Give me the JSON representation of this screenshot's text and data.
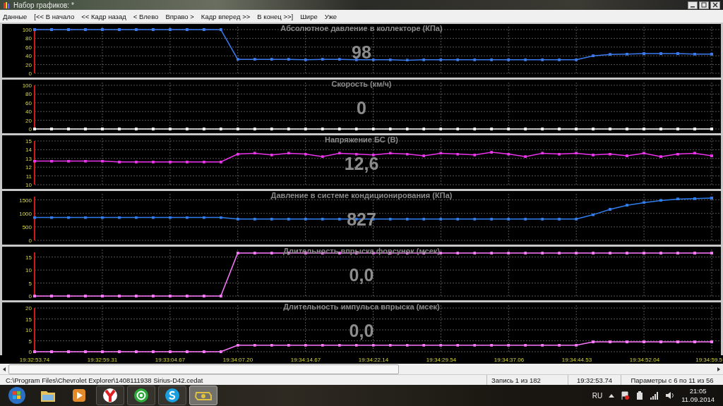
{
  "window": {
    "title": "Набор графиков: *"
  },
  "menu": [
    "Данные",
    "[<< В начало",
    "<< Кадр назад",
    "< Влево",
    "Вправо >",
    "Кадр вперед >>",
    "В конец >>]",
    "Шире",
    "Уже"
  ],
  "panels": [
    {
      "title": "Абсолютное давление в коллекторе  (КПа)",
      "reading": "98",
      "chart_data": {
        "type": "line",
        "grid": true,
        "ylim": [
          0,
          100
        ],
        "yticks": [
          0,
          20,
          40,
          60,
          80,
          100
        ],
        "series": [
          {
            "color": "#3a7cf0",
            "values": [
              100,
              100,
              100,
              100,
              100,
              100,
              100,
              100,
              100,
              100,
              100,
              100,
              32,
              32,
              32,
              32,
              31,
              32,
              32,
              31,
              31,
              31,
              30,
              31,
              31,
              31,
              31,
              31,
              31,
              31,
              31,
              31,
              31,
              40,
              43,
              44,
              45,
              45,
              45,
              44,
              44
            ]
          }
        ]
      }
    },
    {
      "title": "Скорость  (км/ч)",
      "reading": "0",
      "chart_data": {
        "type": "line",
        "grid": true,
        "ylim": [
          0,
          100
        ],
        "yticks": [
          0,
          20,
          40,
          60,
          80,
          100
        ],
        "series": [
          {
            "color": "#ffffff",
            "values": [
              0,
              0,
              0,
              0,
              0,
              0,
              0,
              0,
              0,
              0,
              0,
              0,
              0,
              0,
              0,
              0,
              0,
              0,
              0,
              0,
              0,
              0,
              0,
              0,
              0,
              0,
              0,
              0,
              0,
              0,
              0,
              0,
              0,
              0,
              0,
              0,
              0,
              0,
              0,
              0,
              0
            ]
          }
        ]
      }
    },
    {
      "title": "Напряжение БС  (В)",
      "reading": "12,6",
      "chart_data": {
        "type": "line",
        "grid": true,
        "ylim": [
          10,
          15
        ],
        "yticks": [
          10,
          11,
          12,
          13,
          14,
          15
        ],
        "series": [
          {
            "color": "#ee33ee",
            "values": [
              12.7,
              12.7,
              12.7,
              12.7,
              12.7,
              12.6,
              12.6,
              12.6,
              12.6,
              12.6,
              12.6,
              12.6,
              13.5,
              13.6,
              13.4,
              13.6,
              13.5,
              13.2,
              13.6,
              13.5,
              13.4,
              13.6,
              13.5,
              13.3,
              13.6,
              13.5,
              13.4,
              13.7,
              13.5,
              13.2,
              13.6,
              13.5,
              13.6,
              13.4,
              13.5,
              13.3,
              13.6,
              13.2,
              13.5,
              13.6,
              13.3
            ]
          }
        ]
      }
    },
    {
      "title": "Давление в системе кондиционирования  (КПа)",
      "reading": "827",
      "chart_data": {
        "type": "line",
        "grid": true,
        "ylim": [
          0,
          1620
        ],
        "yticks": [
          0,
          500,
          1000,
          1500
        ],
        "series": [
          {
            "color": "#2f7ff0",
            "values": [
              850,
              850,
              850,
              850,
              850,
              850,
              850,
              850,
              850,
              850,
              850,
              850,
              790,
              790,
              790,
              790,
              790,
              790,
              790,
              790,
              790,
              790,
              790,
              790,
              790,
              790,
              790,
              790,
              790,
              790,
              790,
              790,
              790,
              950,
              1150,
              1300,
              1400,
              1480,
              1530,
              1550,
              1570
            ]
          }
        ]
      }
    },
    {
      "title": "Длительность впрыска форсунок  (мсек)",
      "reading": "0,0",
      "chart_data": {
        "type": "line",
        "grid": true,
        "ylim": [
          0,
          16.8
        ],
        "yticks": [
          0,
          5,
          10,
          15
        ],
        "series": [
          {
            "color": "#ff77ff",
            "values": [
              0,
              0,
              0,
              0,
              0,
              0,
              0,
              0,
              0,
              0,
              0,
              0,
              16.5,
              16.5,
              16.5,
              16.5,
              16.5,
              16.5,
              16.5,
              16.5,
              16.5,
              16.5,
              16.5,
              16.5,
              16.5,
              16.5,
              16.5,
              16.5,
              16.5,
              16.5,
              16.5,
              16.5,
              16.5,
              16.5,
              16.5,
              16.5,
              16.5,
              16.5,
              16.5,
              16.5,
              16.5
            ]
          }
        ]
      }
    },
    {
      "title": "Длительность импульса впрыска  (мсек)",
      "reading": "0,0",
      "chart_data": {
        "type": "line",
        "grid": true,
        "ylim": [
          0,
          20
        ],
        "yticks": [
          0,
          5,
          10,
          15,
          20
        ],
        "series": [
          {
            "color": "#ff77ff",
            "values": [
              0,
              0,
              0,
              0,
              0,
              0,
              0,
              0,
              0,
              0,
              0,
              0,
              3,
              3,
              3,
              3,
              3,
              3,
              3,
              3,
              3,
              3,
              3,
              3,
              3,
              3,
              3,
              3,
              3,
              3,
              3,
              3,
              3,
              4.5,
              4.5,
              4.5,
              4.5,
              4.5,
              4.5,
              4.5,
              4.5
            ]
          }
        ]
      }
    }
  ],
  "time_axis": [
    "19:32:53.74",
    "19:32:59.31",
    "19:33:04.67",
    "19:34:07.20",
    "19:34:14.67",
    "19:34:22.14",
    "19:34:29.54",
    "19:34:37.06",
    "19:34:44.53",
    "19:34:52.04",
    "19:34:59.5"
  ],
  "status_bar": {
    "file": "C:\\Program Files\\Chevrolet Explorer\\1408111938 Sirius-D42.cedat",
    "record": "Запись 1 из 182",
    "time": "19:32:53.74",
    "params": "Параметры с 6 по 11 из 56"
  },
  "taskbar": {
    "language": "RU",
    "time": "21:05",
    "date": "11.09.2014"
  }
}
